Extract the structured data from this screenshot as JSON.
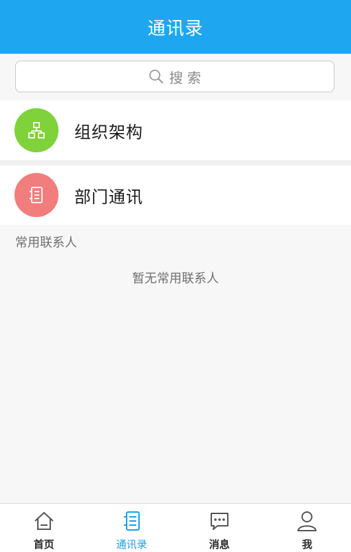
{
  "header": {
    "title": "通讯录"
  },
  "search": {
    "placeholder": "搜 索",
    "icon": "search-icon"
  },
  "menu": [
    {
      "label": "组织架构",
      "icon": "org-chart-icon",
      "color": "#7fd23a"
    },
    {
      "label": "部门通讯",
      "icon": "list-icon",
      "color": "#f27d7d"
    }
  ],
  "frequent": {
    "section_title": "常用联系人",
    "empty_text": "暂无常用联系人"
  },
  "tabbar": {
    "tabs": [
      {
        "label": "首页",
        "icon": "home-icon",
        "active": false
      },
      {
        "label": "通讯录",
        "icon": "contacts-icon",
        "active": true
      },
      {
        "label": "消息",
        "icon": "chat-icon",
        "active": false
      },
      {
        "label": "我",
        "icon": "user-icon",
        "active": false
      }
    ],
    "active_color": "#1aa0e6"
  },
  "colors": {
    "header_bg": "#1ea7f0",
    "page_bg": "#f7f7f7"
  }
}
